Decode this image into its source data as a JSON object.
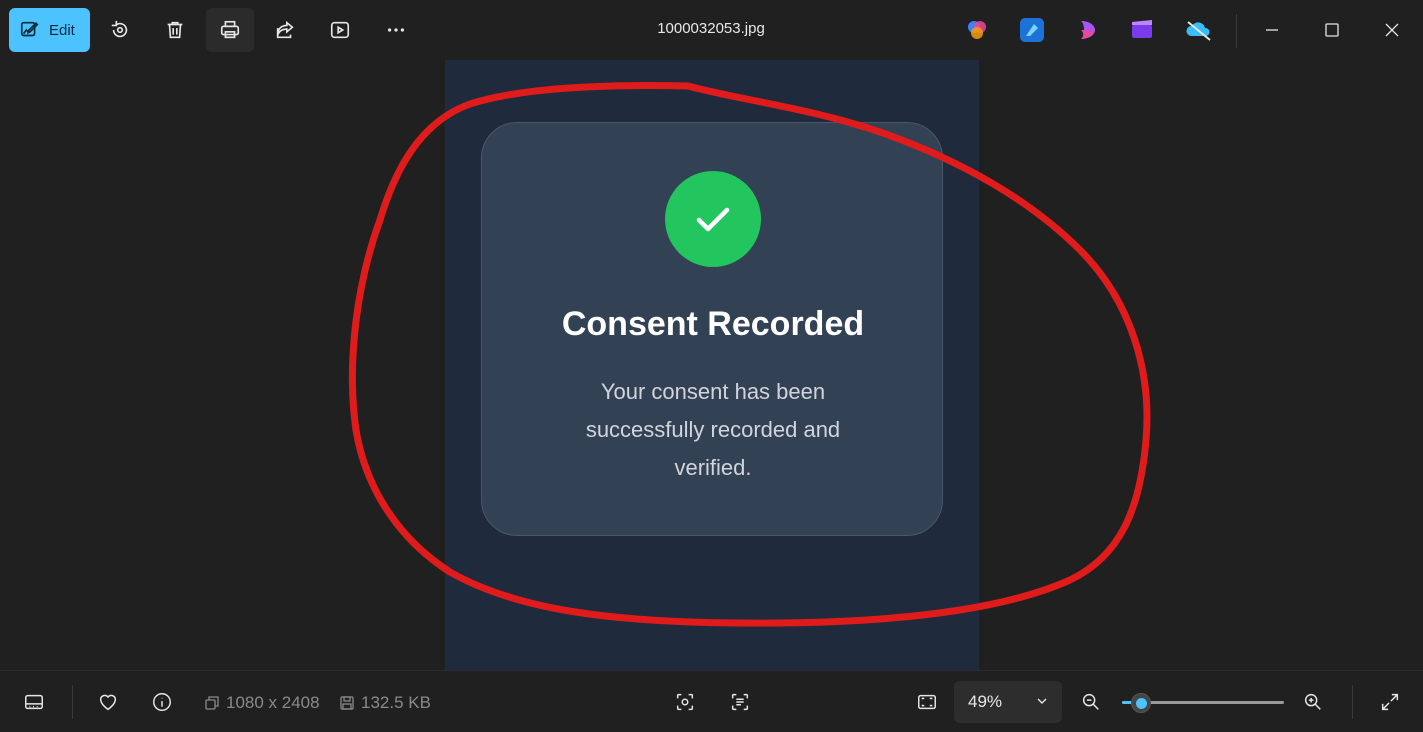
{
  "toolbar": {
    "edit_label": "Edit",
    "file_name": "1000032053.jpg",
    "accent": "#4cc2ff"
  },
  "image": {
    "card_title": "Consent Recorded",
    "card_message": "Your consent has been successfully recorded and verified.",
    "success_color": "#22c55e",
    "annotation_color": "#e01b1b"
  },
  "statusbar": {
    "dimensions": "1080 x 2408",
    "file_size": "132.5 KB",
    "zoom_label": "49%",
    "zoom_level": 0.12
  },
  "icons": {
    "toolbar": [
      "edit-icon",
      "rotate-icon",
      "delete-icon",
      "print-icon",
      "share-icon",
      "slideshow-icon",
      "more-icon"
    ],
    "apps": [
      "copilot-icon",
      "designer-icon",
      "clipchamp-icon",
      "video-editor-icon",
      "onedrive-icon"
    ],
    "window": [
      "minimize-icon",
      "maximize-icon",
      "close-icon"
    ],
    "bottom": [
      "filmstrip-icon",
      "favorite-icon",
      "info-icon",
      "visual-search-icon",
      "text-scan-icon",
      "fit-window-icon",
      "zoom-out-icon",
      "zoom-in-icon",
      "fullscreen-icon"
    ]
  }
}
